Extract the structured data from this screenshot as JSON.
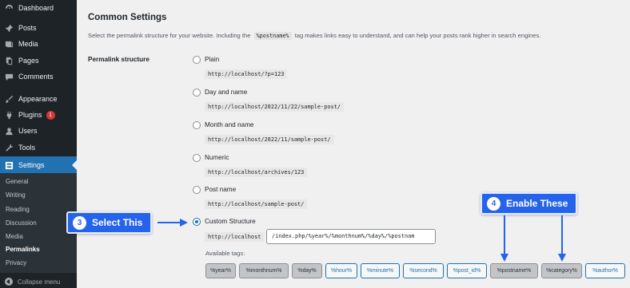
{
  "sidebar": {
    "items": [
      {
        "label": "Dashboard",
        "icon": "dashboard-icon"
      },
      {
        "label": "Posts",
        "icon": "pin-icon"
      },
      {
        "label": "Media",
        "icon": "media-icon"
      },
      {
        "label": "Pages",
        "icon": "pages-icon"
      },
      {
        "label": "Comments",
        "icon": "comment-icon"
      },
      {
        "label": "Appearance",
        "icon": "brush-icon"
      },
      {
        "label": "Plugins",
        "icon": "plug-icon",
        "badge": "1"
      },
      {
        "label": "Users",
        "icon": "user-icon"
      },
      {
        "label": "Tools",
        "icon": "wrench-icon"
      },
      {
        "label": "Settings",
        "icon": "settings-icon",
        "active": true
      }
    ],
    "submenu": [
      "General",
      "Writing",
      "Reading",
      "Discussion",
      "Media",
      "Permalinks",
      "Privacy"
    ],
    "submenu_current": "Permalinks",
    "collapse_label": "Collapse menu"
  },
  "main": {
    "section_title": "Common Settings",
    "intro_before": "Select the permalink structure for your website. Including the",
    "intro_code": "%postname%",
    "intro_after": "tag makes links easy to understand, and can help your posts rank higher in search engines.",
    "row_label": "Permalink structure",
    "options": [
      {
        "label": "Plain",
        "example": "http://localhost/?p=123",
        "checked": false
      },
      {
        "label": "Day and name",
        "example": "http://localhost/2022/11/22/sample-post/",
        "checked": false
      },
      {
        "label": "Month and name",
        "example": "http://localhost/2022/11/sample-post/",
        "checked": false
      },
      {
        "label": "Numeric",
        "example": "http://localhost/archives/123",
        "checked": false
      },
      {
        "label": "Post name",
        "example": "http://localhost/sample-post/",
        "checked": false
      },
      {
        "label": "Custom Structure",
        "example": "http://localhost",
        "checked": true
      }
    ],
    "custom_value": "/index.php/%year%/%monthnum%/%day%/%postnam",
    "available_tags_label": "Available tags:",
    "tags": [
      {
        "label": "%year%",
        "pressed": true
      },
      {
        "label": "%monthnum%",
        "pressed": true
      },
      {
        "label": "%day%",
        "pressed": true
      },
      {
        "label": "%hour%",
        "pressed": false
      },
      {
        "label": "%minute%",
        "pressed": false
      },
      {
        "label": "%second%",
        "pressed": false
      },
      {
        "label": "%post_id%",
        "pressed": false
      },
      {
        "label": "%postname%",
        "pressed": true
      },
      {
        "label": "%category%",
        "pressed": true
      },
      {
        "label": "%author%",
        "pressed": false
      }
    ]
  },
  "callouts": {
    "select": {
      "number": "3",
      "text": "Select This"
    },
    "enable": {
      "number": "4",
      "text": "Enable These"
    }
  },
  "colors": {
    "sidebar_bg": "#1d2327",
    "accent": "#2271b1",
    "callout": "#2563eb",
    "badge": "#d63638"
  }
}
